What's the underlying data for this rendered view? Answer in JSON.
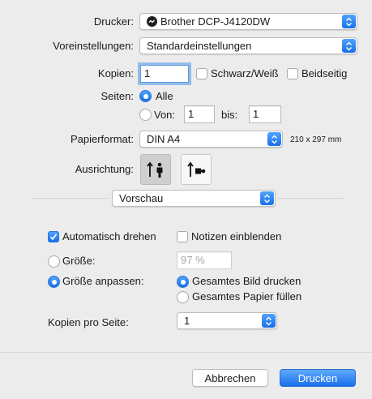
{
  "printer": {
    "label": "Drucker:",
    "value": "Brother DCP-J4120DW",
    "icon": "printer-status-icon"
  },
  "presets": {
    "label": "Voreinstellungen:",
    "value": "Standardeinstellungen"
  },
  "copies": {
    "label": "Kopien:",
    "value": "1",
    "bw_label": "Schwarz/Weiß",
    "duplex_label": "Beidseitig"
  },
  "pages": {
    "label": "Seiten:",
    "all_label": "Alle",
    "from_label": "Von:",
    "from_value": "1",
    "to_label": "bis:",
    "to_value": "1"
  },
  "paper": {
    "label": "Papierformat:",
    "value": "DIN A4",
    "size_text": "210 x 297 mm"
  },
  "orientation": {
    "label": "Ausrichtung:",
    "selected": "portrait"
  },
  "panel_select": {
    "value": "Vorschau"
  },
  "preview": {
    "auto_rotate_label": "Automatisch drehen",
    "show_notes_label": "Notizen einblenden",
    "size_label": "Größe:",
    "size_value": "97 %",
    "scale_to_fit_label": "Größe anpassen:",
    "print_entire_label": "Gesamtes Bild drucken",
    "fill_paper_label": "Gesamtes Papier füllen",
    "copies_per_page_label": "Kopien pro Seite:",
    "copies_per_page_value": "1"
  },
  "buttons": {
    "cancel": "Abbrechen",
    "print": "Drucken"
  },
  "colors": {
    "accent": "#1a6fe8",
    "background": "#ececec"
  }
}
